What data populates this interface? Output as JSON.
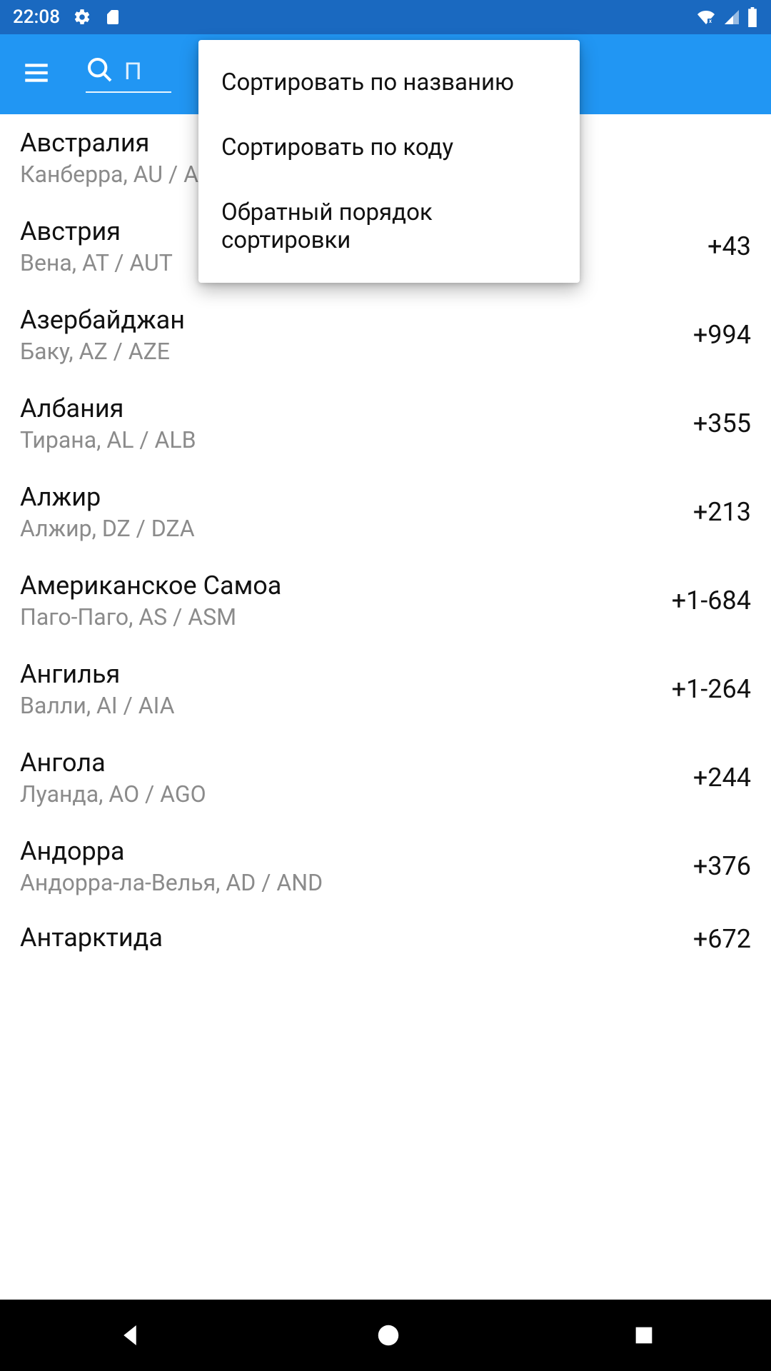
{
  "status_bar": {
    "time": "22:08"
  },
  "app_bar": {
    "search_placeholder": "П"
  },
  "popup_menu": {
    "items": [
      "Сортировать по названию",
      "Сортировать по коду",
      "Обратный порядок сортировки"
    ]
  },
  "countries": [
    {
      "name": "Австралия",
      "sub": "Канберра, AU / AUS",
      "code": ""
    },
    {
      "name": "Австрия",
      "sub": "Вена, AT / AUT",
      "code": "+43"
    },
    {
      "name": "Азербайджан",
      "sub": "Баку, AZ / AZE",
      "code": "+994"
    },
    {
      "name": "Албания",
      "sub": "Тирана, AL / ALB",
      "code": "+355"
    },
    {
      "name": "Алжир",
      "sub": "Алжир, DZ / DZA",
      "code": "+213"
    },
    {
      "name": "Американское Самоа",
      "sub": "Паго-Паго, AS / ASM",
      "code": "+1-684"
    },
    {
      "name": "Ангилья",
      "sub": "Валли, AI / AIA",
      "code": "+1-264"
    },
    {
      "name": "Ангола",
      "sub": "Луанда, AO / AGO",
      "code": "+244"
    },
    {
      "name": "Андорра",
      "sub": "Андорра-ла-Велья, AD / AND",
      "code": "+376"
    },
    {
      "name": "Антарктида",
      "sub": "",
      "code": "+672"
    }
  ]
}
